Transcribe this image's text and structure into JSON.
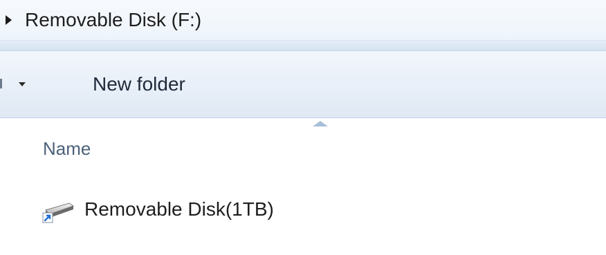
{
  "address_bar": {
    "path": "Removable Disk (F:)",
    "expand_icon": "triangle-right-icon"
  },
  "toolbar": {
    "dropdown_icon": "caret-down-icon",
    "new_folder_label": "New folder"
  },
  "columns": {
    "name_label": "Name",
    "sort_icon": "sort-ascending-icon"
  },
  "files": [
    {
      "name": "Removable Disk(1TB)",
      "icon": "removable-drive-shortcut-icon"
    }
  ],
  "colors": {
    "toolbar_bg": "#e8eff8",
    "header_text": "#4c607a",
    "text": "#1e1e1e"
  }
}
